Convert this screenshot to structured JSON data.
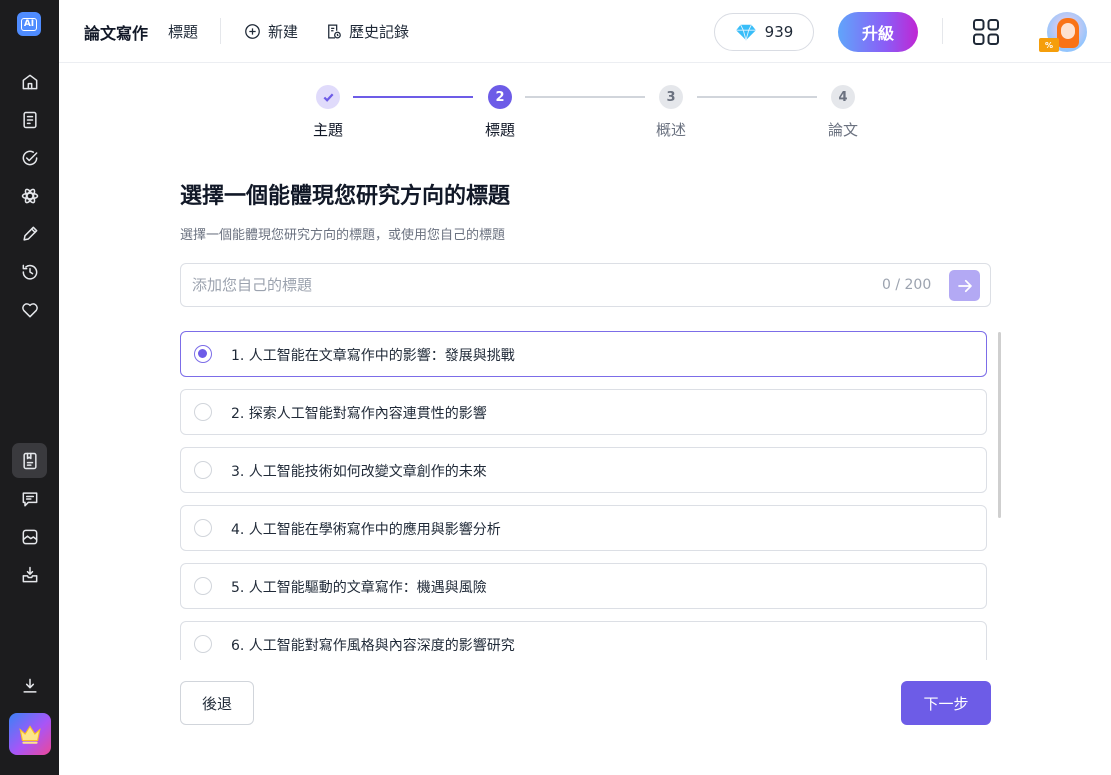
{
  "app": {
    "logo_text": "AI",
    "title": "論文寫作"
  },
  "header": {
    "nav": [
      {
        "label": "標題",
        "icon": "none"
      },
      {
        "label": "新建",
        "icon": "plus-circle-icon"
      },
      {
        "label": "歷史記錄",
        "icon": "history-doc-icon"
      }
    ],
    "credits": "939",
    "upgrade_label": "升級",
    "avatar_badge": "%"
  },
  "sidebar": {
    "items": [
      {
        "name": "home-icon"
      },
      {
        "name": "document-icon"
      },
      {
        "name": "check-circle-icon"
      },
      {
        "name": "atom-icon"
      },
      {
        "name": "pencil-icon"
      },
      {
        "name": "history-icon"
      },
      {
        "name": "heart-icon"
      },
      {
        "name": "paper-writing-icon",
        "active": true
      },
      {
        "name": "chat-icon"
      },
      {
        "name": "image-icon"
      },
      {
        "name": "inbox-icon"
      },
      {
        "name": "download-icon"
      },
      {
        "name": "crown-icon"
      }
    ]
  },
  "stepper": {
    "steps": [
      {
        "number": "1",
        "label": "主題",
        "state": "done"
      },
      {
        "number": "2",
        "label": "標題",
        "state": "current"
      },
      {
        "number": "3",
        "label": "概述",
        "state": "todo"
      },
      {
        "number": "4",
        "label": "論文",
        "state": "todo"
      }
    ]
  },
  "main": {
    "heading": "選擇一個能體現您研究方向的標題",
    "subheading": "選擇一個能體現您研究方向的標題，或使用您自己的標題",
    "input": {
      "placeholder": "添加您自己的標題",
      "value": "",
      "char_count": "0 / 200"
    },
    "options": [
      {
        "label": "1. 人工智能在文章寫作中的影響：發展與挑戰",
        "selected": true
      },
      {
        "label": "2. 探索人工智能對寫作內容連貫性的影響",
        "selected": false
      },
      {
        "label": "3. 人工智能技術如何改變文章創作的未來",
        "selected": false
      },
      {
        "label": "4. 人工智能在學術寫作中的應用與影響分析",
        "selected": false
      },
      {
        "label": "5. 人工智能驅動的文章寫作：機遇與風險",
        "selected": false
      },
      {
        "label": "6. 人工智能對寫作風格與內容深度的影響研究",
        "selected": false
      }
    ]
  },
  "footer": {
    "back_label": "後退",
    "next_label": "下一步"
  },
  "colors": {
    "accent": "#6d5ce7",
    "sidebar_bg": "#1c1c1e"
  }
}
